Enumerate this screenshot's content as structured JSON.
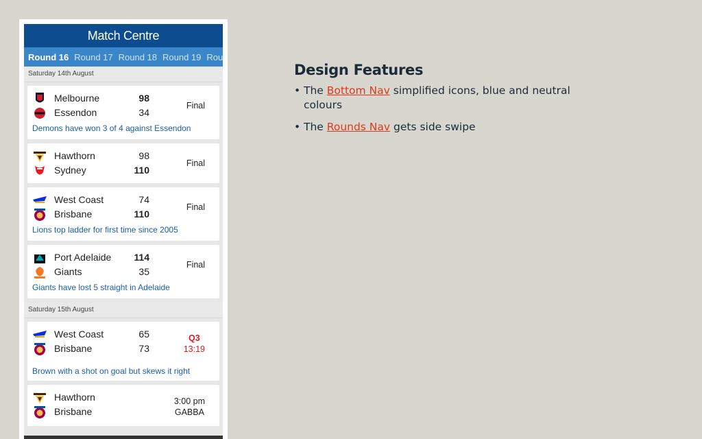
{
  "app": {
    "title": "Match Centre"
  },
  "rounds_nav": {
    "tabs": [
      "Round 16",
      "Round 17",
      "Round 18",
      "Round 19",
      "Rou"
    ],
    "active_index": 0
  },
  "days": [
    {
      "date": "Saturday 14th August",
      "matches": [
        {
          "home": "Melbourne",
          "home_score": "98",
          "away": "Essendon",
          "away_score": "34",
          "winner": "home",
          "status": "Final",
          "note": "Demons have won 3 of 4 against Essendon",
          "home_logo": "melbourne-logo",
          "away_logo": "essendon-logo"
        },
        {
          "home": "Hawthorn",
          "home_score": "98",
          "away": "Sydney",
          "away_score": "110",
          "winner": "away",
          "status": "Final",
          "note": "",
          "home_logo": "hawthorn-logo",
          "away_logo": "sydney-logo"
        },
        {
          "home": "West Coast",
          "home_score": "74",
          "away": "Brisbane",
          "away_score": "110",
          "winner": "away",
          "status": "Final",
          "note": "Lions top ladder for first time since 2005",
          "home_logo": "west-coast-logo",
          "away_logo": "brisbane-logo"
        },
        {
          "home": "Port Adelaide",
          "home_score": "114",
          "away": "Giants",
          "away_score": "35",
          "winner": "home",
          "status": "Final",
          "note": "Giants have lost 5 straight in Adelaide",
          "home_logo": "port-adelaide-logo",
          "away_logo": "giants-logo"
        }
      ]
    },
    {
      "date": "Saturday 15th August",
      "matches": [
        {
          "home": "West Coast",
          "home_score": "65",
          "away": "Brisbane",
          "away_score": "73",
          "winner": "",
          "status": "Q3",
          "clock": "13:19",
          "live": true,
          "note": "Brown with a shot on goal but skews it right",
          "home_logo": "west-coast-logo",
          "away_logo": "brisbane-logo"
        },
        {
          "home": "Hawthorn",
          "home_score": "",
          "away": "Brisbane",
          "away_score": "",
          "winner": "",
          "status": "3:00 pm",
          "clock": "GABBA",
          "note": "",
          "home_logo": "hawthorn-logo",
          "away_logo": "brisbane-logo"
        }
      ]
    }
  ],
  "features": {
    "heading": "Design Features",
    "items": [
      {
        "prefix": "The ",
        "link": "Bottom Nav",
        "suffix": " simplified icons, blue and neutral colours"
      },
      {
        "prefix": "The ",
        "link": "Rounds Nav",
        "suffix": " gets side swipe"
      }
    ]
  },
  "colors": {
    "titlebar": "#0b4d8e",
    "rounds_nav": "#3a86c8",
    "note_text": "#1a5fa4",
    "live": "#e01818",
    "link": "#e0391a"
  }
}
